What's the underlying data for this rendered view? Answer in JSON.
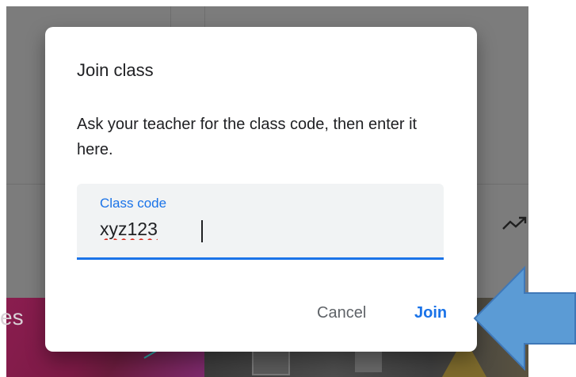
{
  "background": {
    "card_text": "es"
  },
  "dialog": {
    "title": "Join class",
    "instructions": "Ask your teacher for the class code, then enter it here.",
    "field": {
      "label": "Class code",
      "value": "xyz123"
    },
    "buttons": {
      "cancel": "Cancel",
      "join": "Join"
    }
  },
  "icons": {
    "trend": "trending-up-icon",
    "annotation_arrow": "arrow-left-icon"
  },
  "colors": {
    "accent": "#1a73e8",
    "scrim": "#7c7c7c",
    "arrow_fill": "#5b9bd5",
    "arrow_stroke": "#3f78b8",
    "spell_underline": "#d93025"
  }
}
